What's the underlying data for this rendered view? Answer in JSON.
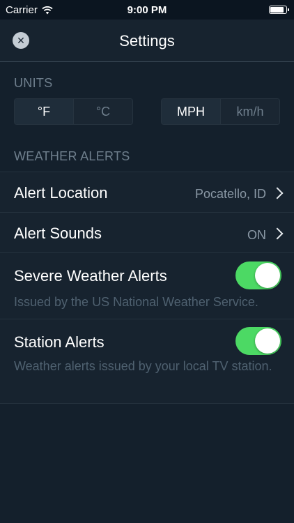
{
  "status_bar": {
    "carrier": "Carrier",
    "time": "9:00 PM"
  },
  "nav": {
    "title": "Settings",
    "close_icon": "close-icon"
  },
  "units": {
    "header": "UNITS",
    "temperature": {
      "options": [
        "°F",
        "°C"
      ],
      "selected": "°F"
    },
    "speed": {
      "options": [
        "MPH",
        "km/h"
      ],
      "selected": "MPH"
    }
  },
  "weather_alerts": {
    "header": "WEATHER ALERTS",
    "alert_location": {
      "label": "Alert Location",
      "value": "Pocatello, ID"
    },
    "alert_sounds": {
      "label": "Alert Sounds",
      "value": "ON"
    },
    "severe_weather": {
      "label": "Severe Weather Alerts",
      "description": "Issued by the US National Weather Service.",
      "enabled": true
    },
    "station_alerts": {
      "label": "Station Alerts",
      "description": "Weather alerts issued by your local TV station.",
      "enabled": true
    }
  },
  "colors": {
    "background": "#14202c",
    "toggle_on": "#4cd964",
    "muted_text": "#6f7f8d"
  }
}
